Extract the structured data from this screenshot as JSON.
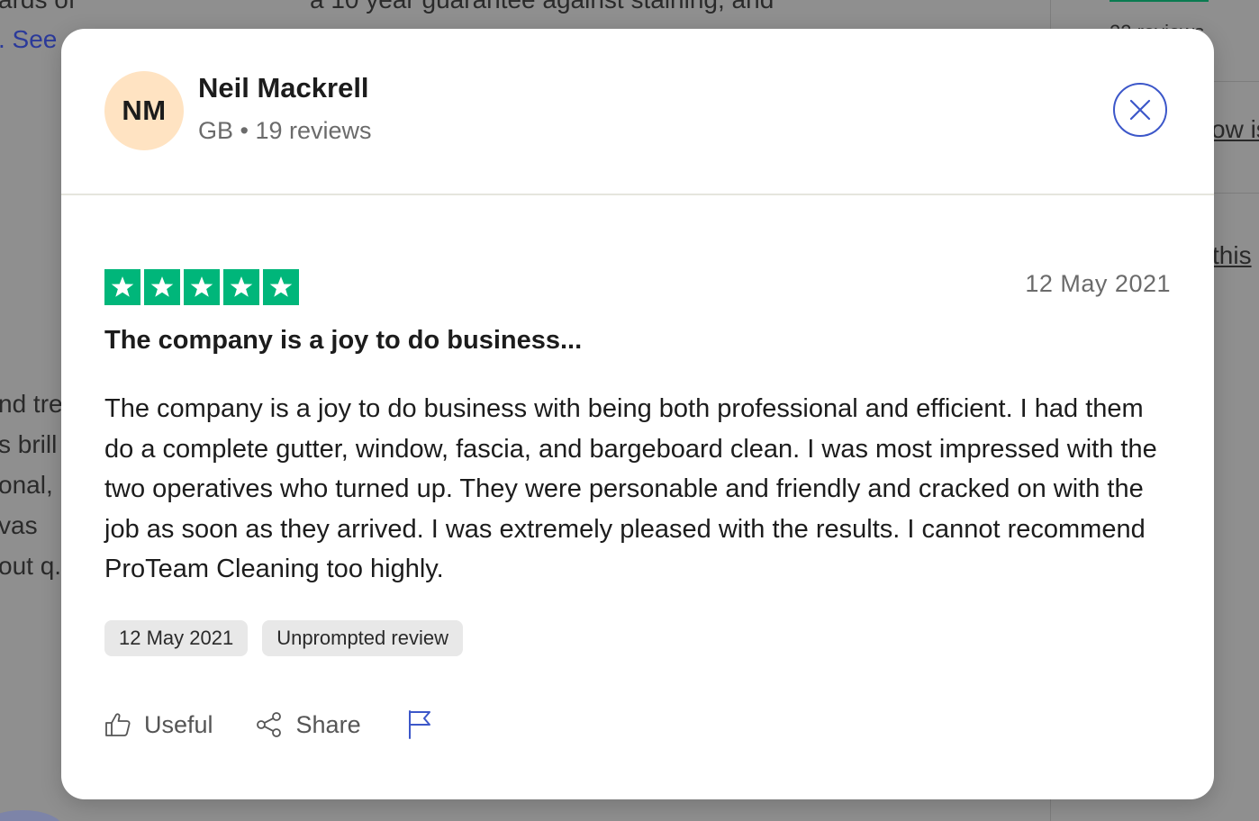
{
  "background": {
    "fragments": [
      "ards of",
      ". See",
      "a 10 year guarantee against staining, and",
      "22 reviews",
      "ow is",
      "this",
      "nd tre",
      "s brill",
      "onal,",
      "vas",
      "out q."
    ]
  },
  "reviewer": {
    "initials": "NM",
    "name": "Neil Mackrell",
    "meta": "GB • 19 reviews"
  },
  "review": {
    "rating": 5,
    "date": "12 May 2021",
    "title": "The company is a joy to do business...",
    "body": "The company is a joy to do business with being both professional and efficient. I had them do a complete gutter, window, fascia, and bargeboard clean. I was most impressed with the two operatives who turned up. They were personable and friendly and cracked on with the job as soon as they arrived. I was extremely pleased with the results. I cannot recommend ProTeam Cleaning too highly.",
    "tags": [
      "12 May 2021",
      "Unprompted review"
    ]
  },
  "actions": {
    "useful_label": "Useful",
    "share_label": "Share"
  },
  "icons": {
    "close": "close-icon",
    "star": "star-icon",
    "useful": "thumbs-up-icon",
    "share": "share-icon",
    "report": "flag-icon"
  },
  "colors": {
    "star_green": "#00b67a",
    "accent_blue": "#3c57c9",
    "avatar_bg": "#ffe3c2"
  }
}
